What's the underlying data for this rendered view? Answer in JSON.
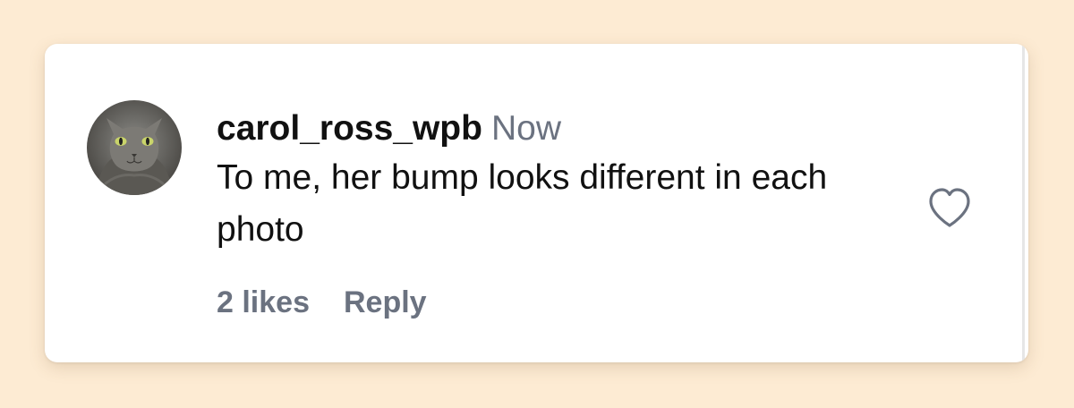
{
  "comment": {
    "username": "carol_ross_wpb",
    "timestamp": "Now",
    "text": "To me, her bump looks different in each photo",
    "likes_label": "2 likes",
    "reply_label": "Reply",
    "avatar_icon": "cat-avatar",
    "like_icon": "heart-outline-icon"
  },
  "colors": {
    "background": "#fdebd3",
    "card": "#ffffff",
    "primary_text": "#111111",
    "secondary_text": "#6b7280"
  }
}
